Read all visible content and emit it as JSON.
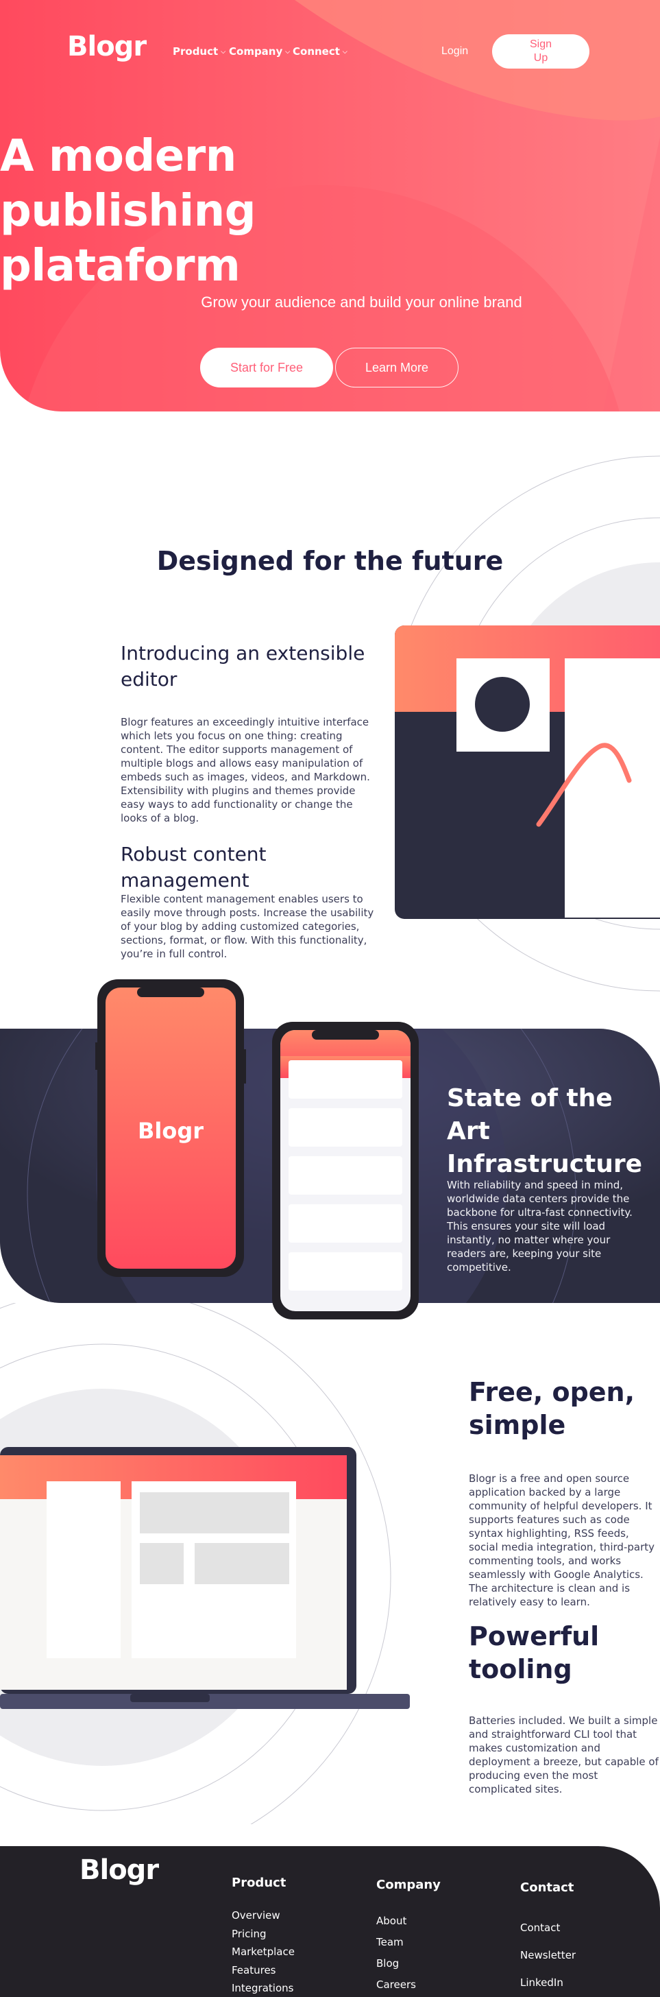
{
  "colors": {
    "brand_red": "#ff525d",
    "brand_pink": "#ff7a85",
    "dark_navy": "#2c2d40",
    "footer_dark": "#232127",
    "heading_text": "#1f2041"
  },
  "nav": {
    "logo": "Blogr",
    "items": [
      {
        "label": "Product",
        "icon": "chevron-down-icon"
      },
      {
        "label": "Company",
        "icon": "chevron-down-icon"
      },
      {
        "label": "Connect",
        "icon": "chevron-down-icon"
      }
    ],
    "login_label": "Login",
    "signup_label": "Sign Up"
  },
  "hero": {
    "title": "A modern publishing plataform",
    "subtitle": "Grow your audience and build your online brand",
    "primary_button": "Start for Free",
    "secondary_button": "Learn More"
  },
  "future": {
    "title": "Designed for the future",
    "features": [
      {
        "heading": "Introducing an extensible editor",
        "text": "Blogr features an exceedingly intuitive interface which lets you focus on one thing: creating content. The editor supports management of multiple blogs and allows easy manipulation of embeds such as images, videos, and Markdown. Extensibility with plugins and themes provide easy ways to add functionality or change the looks of a blog."
      },
      {
        "heading": "Robust content management",
        "text": "Flexible content management enables users to easily move through posts. Increase the usability of your blog by adding customized categories, sections, format, or flow. With this functionality, you’re in full control."
      }
    ]
  },
  "infrastructure": {
    "title": "State of the Art Infrastructure",
    "text": "With reliability and speed in mind, worldwide data centers provide the backbone for ultra-fast connectivity. This ensures your site will load instantly, no matter where your readers are, keeping your site competitive.",
    "phone_logo": "Blogr"
  },
  "features2": [
    {
      "heading": "Free, open, simple",
      "text": "Blogr is a free and open source application backed by a large community of helpful developers. It supports features such as code syntax highlighting, RSS feeds, social media integration, third-party commenting tools, and works seamlessly with Google Analytics. The architecture is clean and is relatively easy to learn."
    },
    {
      "heading": "Powerful tooling",
      "text": "Batteries included. We built a simple and straightforward CLI tool that makes customization and deployment a breeze, but capable of producing even the most complicated sites."
    }
  ],
  "footer": {
    "logo": "Blogr",
    "columns": [
      {
        "heading": "Product",
        "links": [
          "Overview",
          "Pricing",
          "Marketplace",
          "Features",
          "Integrations"
        ]
      },
      {
        "heading": "Company",
        "links": [
          "About",
          "Team",
          "Blog",
          "Careers"
        ]
      },
      {
        "heading": "Contact",
        "links": [
          "Contact",
          "Newsletter",
          "LinkedIn"
        ]
      }
    ]
  }
}
